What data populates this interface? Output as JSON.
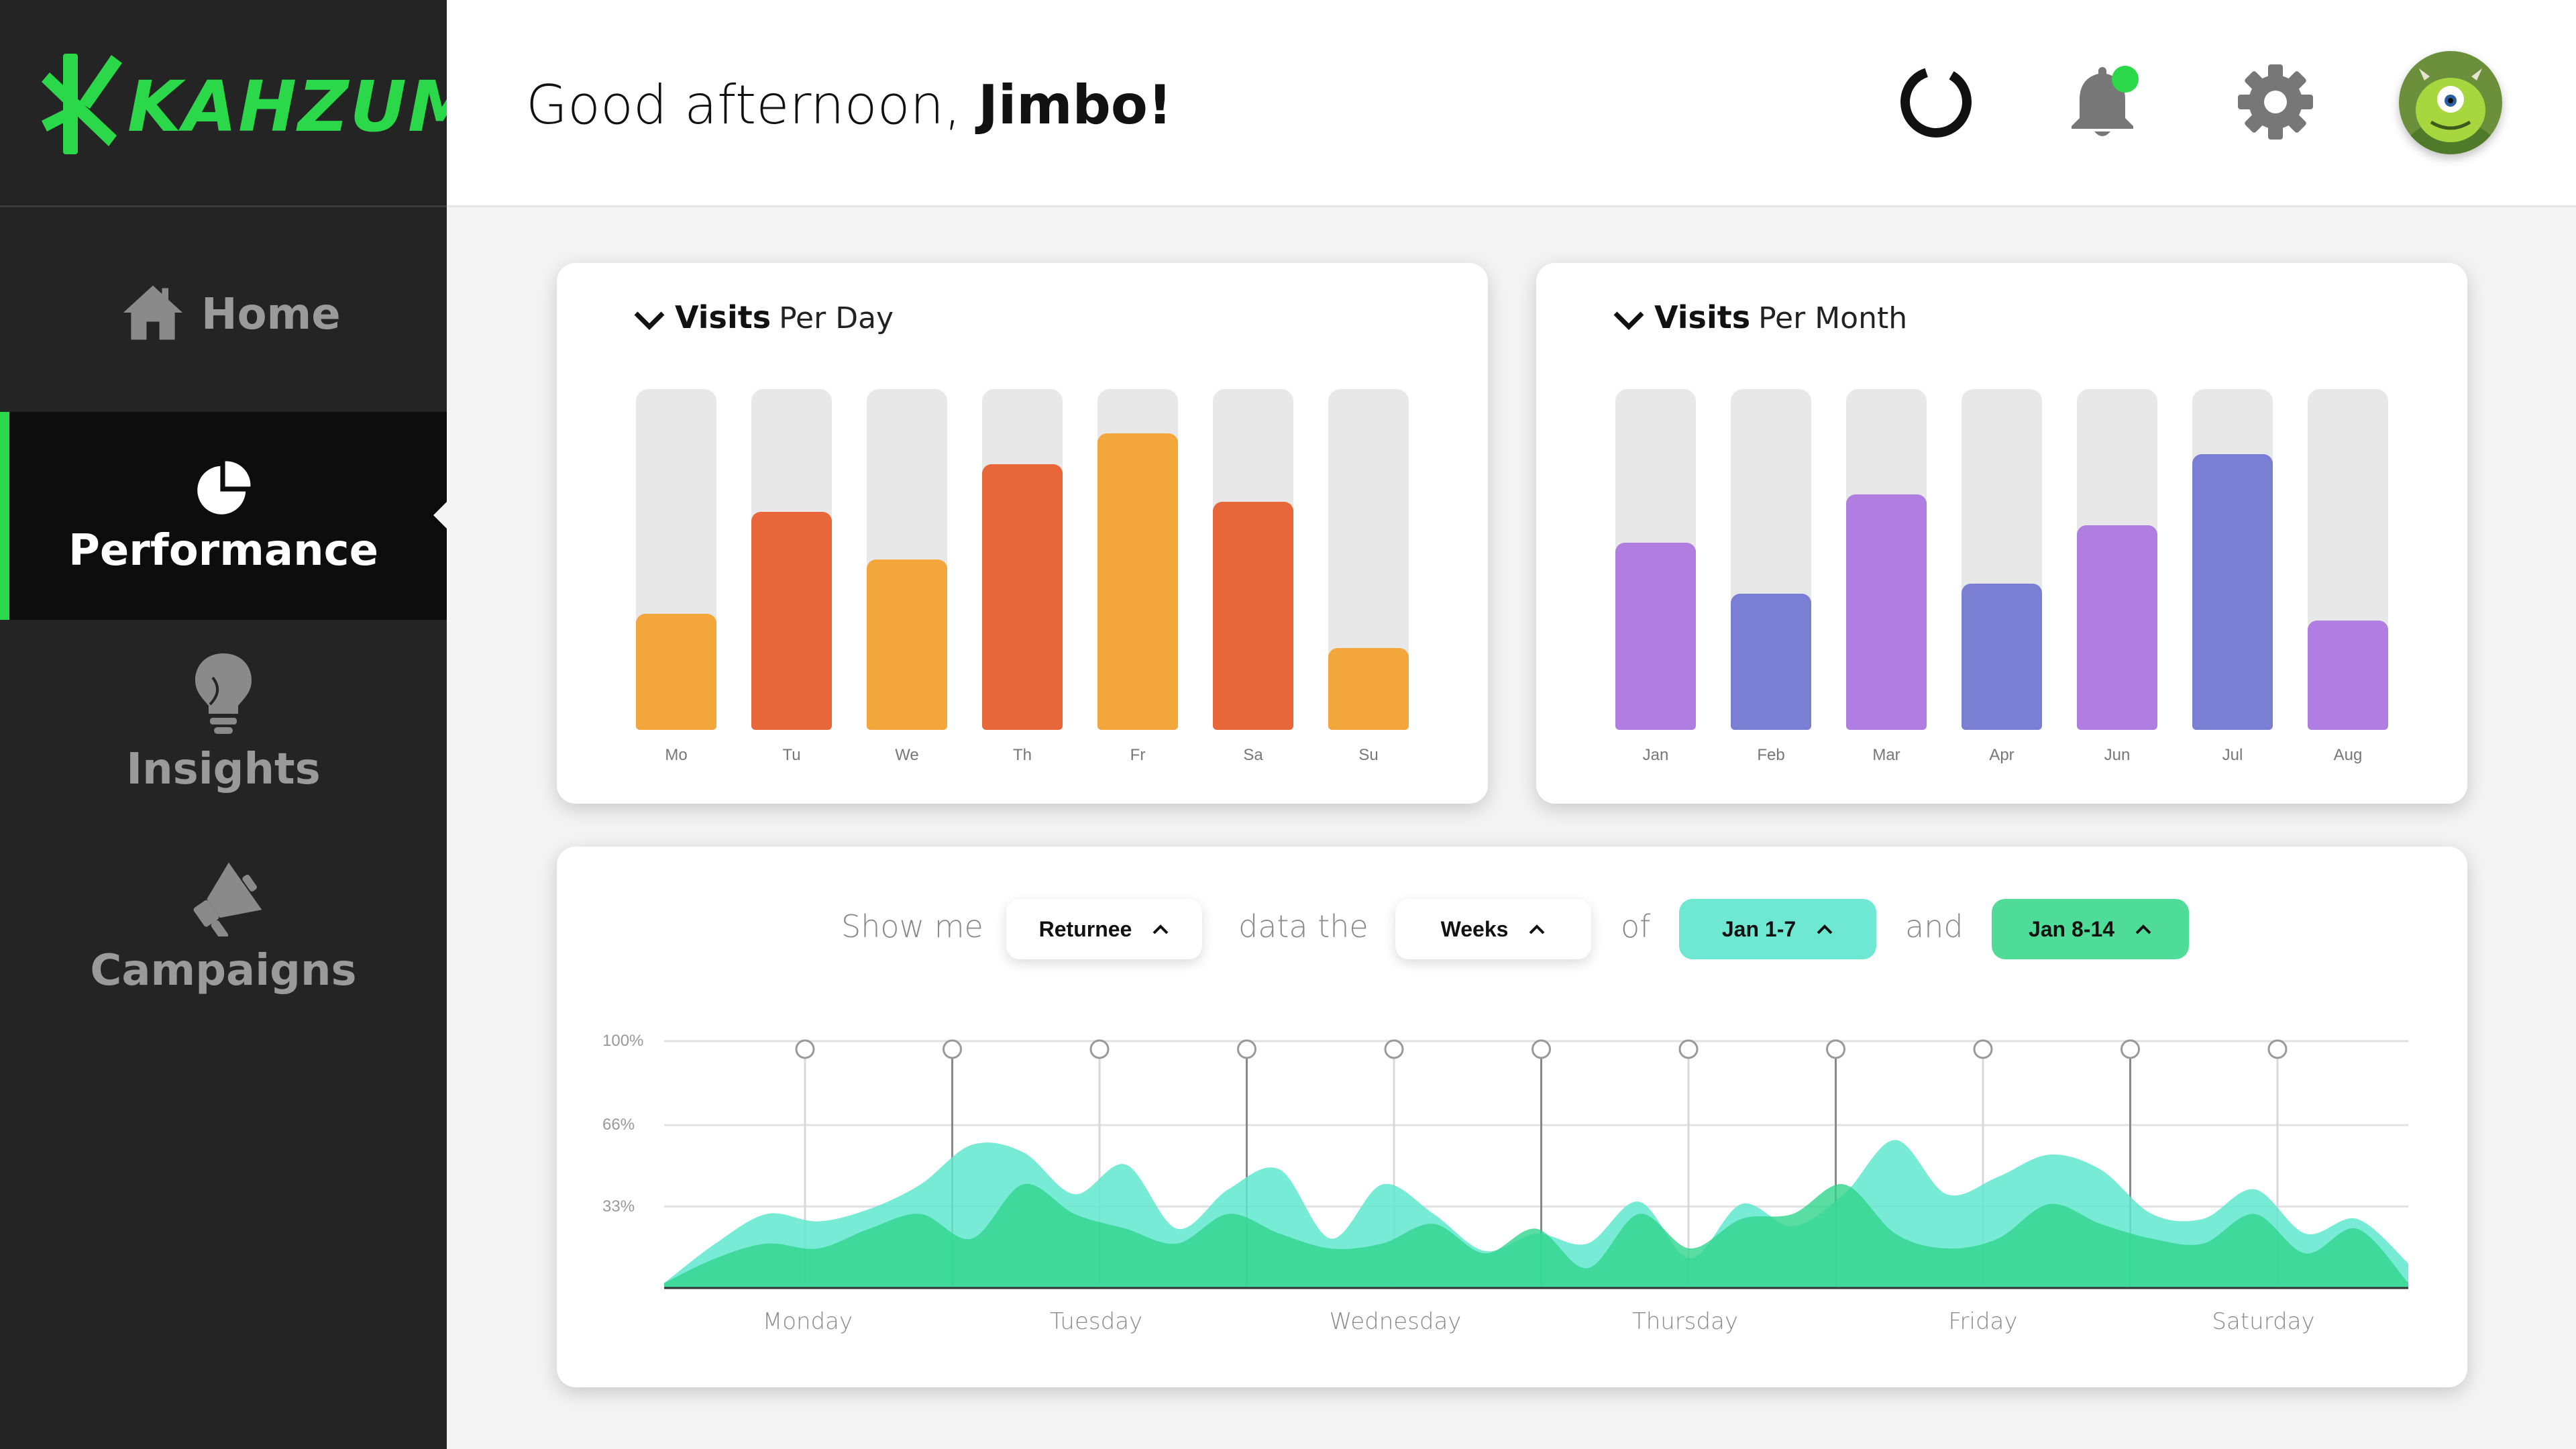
{
  "app": {
    "brand": "KAHZUM",
    "brand_color": "#2ad84a"
  },
  "header": {
    "greeting_prefix": "Good afternoon, ",
    "user_name": "Jimbo!"
  },
  "sidebar": {
    "items": [
      {
        "label": "Home",
        "icon": "home-icon",
        "active": false
      },
      {
        "label": "Performance",
        "icon": "pie-chart-icon",
        "active": true
      },
      {
        "label": "Insights",
        "icon": "lightbulb-icon",
        "active": false
      },
      {
        "label": "Campaigns",
        "icon": "megaphone-icon",
        "active": false
      }
    ]
  },
  "notifications": {
    "unread_dot_color": "#2ad84a"
  },
  "cards": {
    "per_day": {
      "title_bold": "Visits",
      "title_light": "Per Day"
    },
    "per_month": {
      "title_bold": "Visits",
      "title_light": "Per Month"
    }
  },
  "filters": {
    "show_me": "Show me",
    "metric": "Returnee",
    "data_the": "data the",
    "period": "Weeks",
    "of": "of",
    "range_a": "Jan 1-7",
    "and": "and",
    "range_b": "Jan 8-14"
  },
  "chart_data": [
    {
      "type": "bar",
      "title": "Visits Per Day",
      "categories": [
        "Mo",
        "Tu",
        "We",
        "Th",
        "Fr",
        "Sa",
        "Su"
      ],
      "values": [
        34,
        64,
        50,
        78,
        87,
        67,
        24
      ],
      "colors": [
        "#f2a63b",
        "#e8673a",
        "#f2a63b",
        "#e8673a",
        "#f2a63b",
        "#e8673a",
        "#f2a63b"
      ],
      "ylim": [
        0,
        100
      ]
    },
    {
      "type": "bar",
      "title": "Visits Per Month",
      "categories": [
        "Jan",
        "Feb",
        "Mar",
        "Apr",
        "Jun",
        "Jul",
        "Aug"
      ],
      "values": [
        55,
        40,
        69,
        43,
        60,
        81,
        32
      ],
      "colors": [
        "#b07ee0",
        "#7a7fd4",
        "#b07ee0",
        "#7a7fd4",
        "#b07ee0",
        "#7a7fd4",
        "#b07ee0"
      ],
      "ylim": [
        0,
        100
      ]
    },
    {
      "type": "area",
      "x_labels": [
        "Monday",
        "Tuesday",
        "Wednesday",
        "Thursday",
        "Friday",
        "Saturday"
      ],
      "y_ticks": [
        "100%",
        "66%",
        "33%"
      ],
      "ylim": [
        0,
        100
      ],
      "series": [
        {
          "color": "#5fe8cf",
          "values": [
            2,
            18,
            30,
            27,
            32,
            42,
            58,
            55,
            38,
            50,
            24,
            40,
            48,
            20,
            42,
            30,
            15,
            22,
            18,
            35,
            12,
            34,
            25,
            38,
            60,
            38,
            45,
            54,
            48,
            30,
            28,
            40,
            22,
            28,
            10
          ]
        },
        {
          "color": "#2fd58c",
          "values": [
            2,
            12,
            18,
            16,
            24,
            30,
            20,
            42,
            30,
            24,
            18,
            30,
            22,
            16,
            18,
            26,
            14,
            24,
            8,
            30,
            16,
            28,
            30,
            42,
            22,
            16,
            20,
            34,
            26,
            20,
            18,
            30,
            14,
            24,
            2
          ]
        }
      ]
    }
  ]
}
